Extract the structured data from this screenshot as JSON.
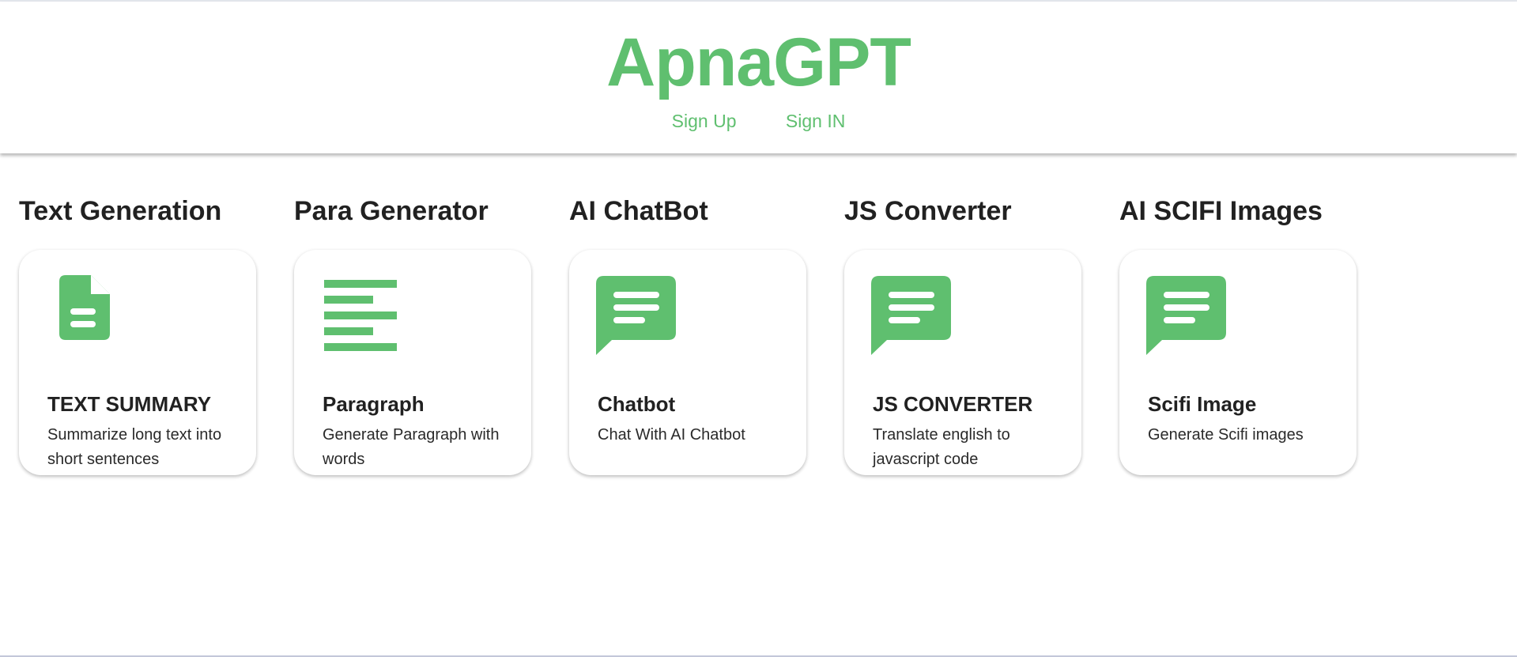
{
  "brand": {
    "title": "ApnaGPT",
    "color": "#5fbf6f"
  },
  "nav": {
    "sign_up": "Sign Up",
    "sign_in": "Sign IN"
  },
  "features": [
    {
      "title": "Text Generation",
      "icon": "document-icon",
      "heading": "TEXT SUMMARY",
      "description": "Summarize long text into short sentences"
    },
    {
      "title": "Para Generator",
      "icon": "paragraph-lines-icon",
      "heading": "Paragraph",
      "description": "Generate Paragraph with words"
    },
    {
      "title": "AI ChatBot",
      "icon": "chat-bubble-icon",
      "heading": "Chatbot",
      "description": "Chat With AI Chatbot"
    },
    {
      "title": "JS Converter",
      "icon": "chat-bubble-icon",
      "heading": "JS CONVERTER",
      "description": "Translate english to javascript code"
    },
    {
      "title": "AI SCIFI Images",
      "icon": "chat-bubble-icon",
      "heading": "Scifi Image",
      "description": "Generate Scifi images"
    }
  ]
}
